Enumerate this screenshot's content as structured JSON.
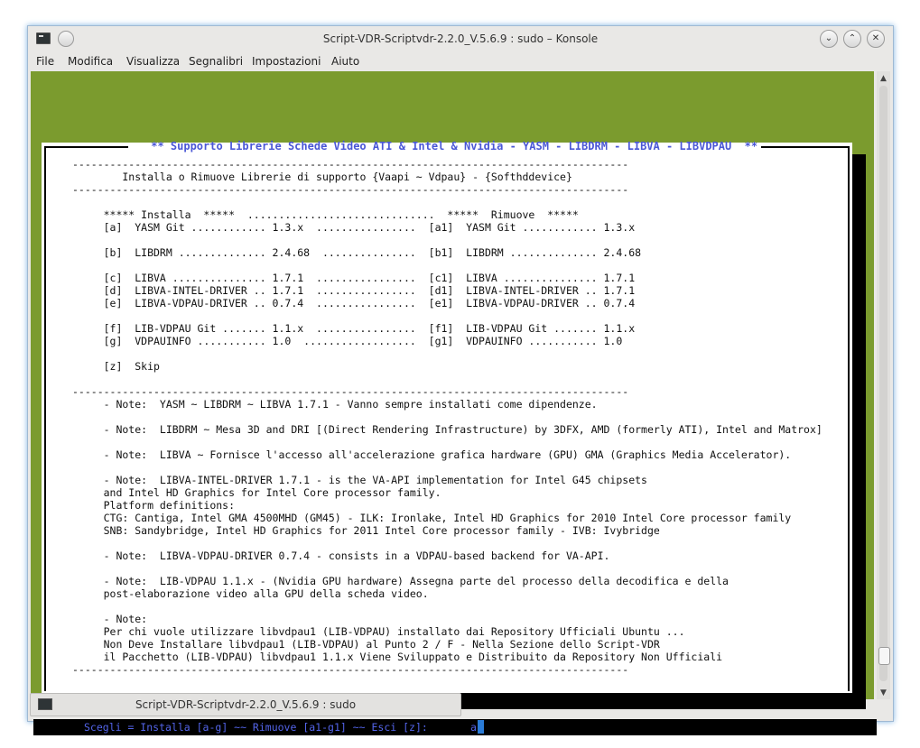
{
  "window": {
    "title": "Script-VDR-Scriptvdr-2.2.0_V.5.6.9 : sudo – Konsole",
    "buttons": {
      "minimize": "⌄",
      "maximize": "⌃",
      "close": "✕"
    }
  },
  "menu": [
    "File",
    "Modifica",
    "Visualizza",
    "Segnalibri",
    "Impostazioni",
    "Aiuto"
  ],
  "dialog": {
    "title": " ** Supporto Librerie Schede Video ATI & Intel & Nvidia - YASM - LIBDRM - LIBVA - LIBVDPAU  ** ",
    "body_lines": [
      "-----------------------------------------------------------------------------------------",
      "        Installa o Rimuove Librerie di supporto {Vaapi ~ Vdpau} - {Softhddevice}",
      "-----------------------------------------------------------------------------------------",
      "",
      "     ***** Installa  *****  ..............................  *****  Rimuove  *****",
      "     [a]  YASM Git ............ 1.3.x  ................  [a1]  YASM Git ............ 1.3.x",
      "",
      "     [b]  LIBDRM .............. 2.4.68  ...............  [b1]  LIBDRM .............. 2.4.68",
      "",
      "     [c]  LIBVA ............... 1.7.1  ................  [c1]  LIBVA ............... 1.7.1",
      "     [d]  LIBVA-INTEL-DRIVER .. 1.7.1  ................  [d1]  LIBVA-INTEL-DRIVER .. 1.7.1",
      "     [e]  LIBVA-VDPAU-DRIVER .. 0.7.4  ................  [e1]  LIBVA-VDPAU-DRIVER .. 0.7.4",
      "",
      "     [f]  LIB-VDPAU Git ....... 1.1.x  ................  [f1]  LIB-VDPAU Git ....... 1.1.x",
      "     [g]  VDPAUINFO ........... 1.0  ..................  [g1]  VDPAUINFO ........... 1.0",
      "",
      "     [z]  Skip",
      "",
      "-----------------------------------------------------------------------------------------",
      "     - Note:  YASM ~ LIBDRM ~ LIBVA 1.7.1 - Vanno sempre installati come dipendenze.",
      "",
      "     - Note:  LIBDRM ~ Mesa 3D and DRI [(Direct Rendering Infrastructure) by 3DFX, AMD (formerly ATI), Intel and Matrox]",
      "",
      "     - Note:  LIBVA ~ Fornisce l'accesso all'accelerazione grafica hardware (GPU) GMA (Graphics Media Accelerator).",
      "",
      "     - Note:  LIBVA-INTEL-DRIVER 1.7.1 - is the VA-API implementation for Intel G45 chipsets",
      "     and Intel HD Graphics for Intel Core processor family.",
      "     Platform definitions:",
      "     CTG: Cantiga, Intel GMA 4500MHD (GM45) - ILK: Ironlake, Intel HD Graphics for 2010 Intel Core processor family",
      "     SNB: Sandybridge, Intel HD Graphics for 2011 Intel Core processor family - IVB: Ivybridge",
      "",
      "     - Note:  LIBVA-VDPAU-DRIVER 0.7.4 - consists in a VDPAU-based backend for VA-API.",
      "",
      "     - Note:  LIB-VDPAU 1.1.x - (Nvidia GPU hardware) Assegna parte del processo della decodifica e della",
      "     post-elaborazione video alla GPU della scheda video.",
      "",
      "     - Note:",
      "     Per chi vuole utilizzare libvdpau1 (LIB-VDPAU) installato dai Repository Ufficiali Ubuntu ...",
      "     Non Deve Installare libvdpau1 (LIB-VDPAU) al Punto 2 / F - Nella Sezione dello Script-VDR",
      "     il Pacchetto (LIB-VDPAU) libvdpau1 1.1.x Viene Sviluppato e Distribuito da Repository Non Ufficiali",
      "-----------------------------------------------------------------------------------------"
    ]
  },
  "prompt": {
    "text": "Scegli = Installa [a-g] ~~ Rimuove [a1-g1] ~~ Esci [z]:",
    "input": "a"
  },
  "taskbar": {
    "label": "Script-VDR-Scriptvdr-2.2.0_V.5.6.9 : sudo"
  },
  "colors": {
    "terminal_bg": "#7b9b2e",
    "dialog_title": "#4a57d6",
    "prompt": "#5364e8",
    "cursor": "#2a7bd6"
  }
}
